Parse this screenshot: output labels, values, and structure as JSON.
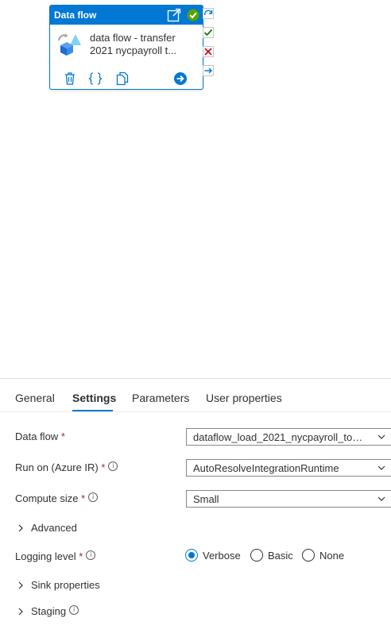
{
  "activity": {
    "header": "Data flow",
    "title_line1": "data flow - transfer",
    "title_line2": "2021 nycpayroll t...",
    "status_color": "#57a300",
    "accent_color": "#0078d4",
    "actions": [
      "delete-icon",
      "code-icon",
      "copy-icon",
      "go-arrow-icon"
    ],
    "connectors": [
      "completion-icon",
      "success-icon",
      "failure-icon",
      "skip-icon"
    ]
  },
  "tabs": [
    {
      "label": "General"
    },
    {
      "label": "Settings",
      "active": true
    },
    {
      "label": "Parameters"
    },
    {
      "label": "User properties"
    }
  ],
  "settings": {
    "data_flow_label": "Data flow",
    "data_flow_value": "dataflow_load_2021_nycpayroll_to_s...",
    "run_on_label": "Run on (Azure IR)",
    "run_on_value": "AutoResolveIntegrationRuntime",
    "compute_size_label": "Compute size",
    "compute_size_value": "Small",
    "advanced_label": "Advanced",
    "logging_level_label": "Logging level",
    "logging_options": [
      {
        "label": "Verbose",
        "selected": true
      },
      {
        "label": "Basic",
        "selected": false
      },
      {
        "label": "None",
        "selected": false
      }
    ],
    "sink_properties_label": "Sink properties",
    "staging_label": "Staging",
    "required_mark": "*",
    "info_glyph": "i"
  }
}
